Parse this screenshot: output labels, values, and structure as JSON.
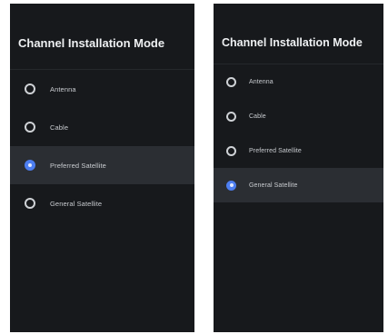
{
  "screens": [
    {
      "title": "Channel Installation Mode",
      "options": [
        {
          "label": "Antenna",
          "selected": false
        },
        {
          "label": "Cable",
          "selected": false
        },
        {
          "label": "Preferred Satellite",
          "selected": true
        },
        {
          "label": "General Satellite",
          "selected": false
        }
      ]
    },
    {
      "title": "Channel Installation Mode",
      "options": [
        {
          "label": "Antenna",
          "selected": false
        },
        {
          "label": "Cable",
          "selected": false
        },
        {
          "label": "Preferred Satellite",
          "selected": false
        },
        {
          "label": "General Satellite",
          "selected": true
        }
      ]
    }
  ],
  "colors": {
    "panel_background": "#17191c",
    "highlight_row": "#2b2e33",
    "radio_selected": "#4d7ef0",
    "text": "#c9ccd0"
  },
  "icons": {
    "radio_unselected": "radio-unselected-icon",
    "radio_selected": "radio-selected-icon"
  }
}
